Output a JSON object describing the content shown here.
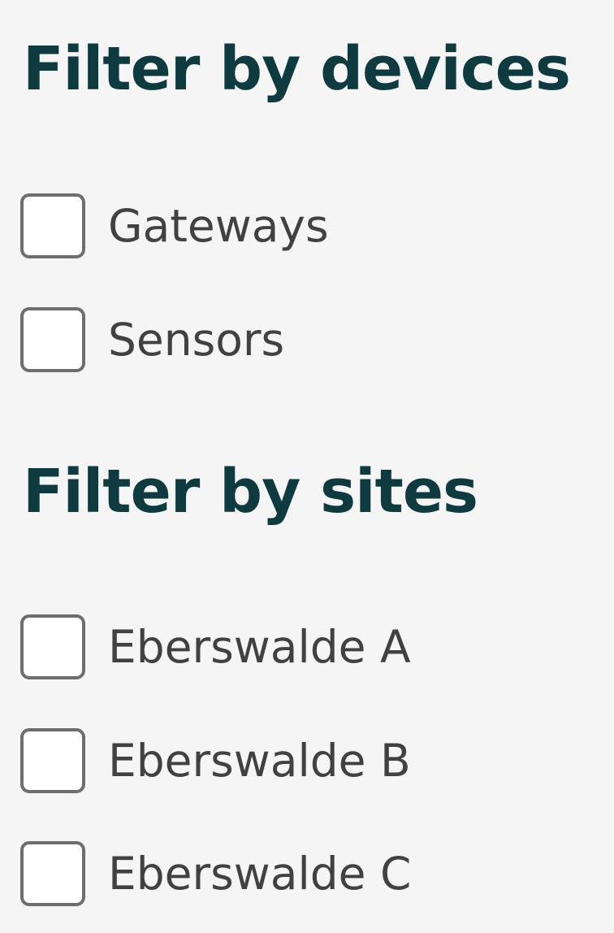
{
  "devices_filter": {
    "title": "Filter by devices",
    "options": [
      {
        "label": "Gateways",
        "checked": false
      },
      {
        "label": "Sensors",
        "checked": false
      }
    ]
  },
  "sites_filter": {
    "title": "Filter by sites",
    "options": [
      {
        "label": "Eberswalde A",
        "checked": false
      },
      {
        "label": "Eberswalde B",
        "checked": false
      },
      {
        "label": "Eberswalde C",
        "checked": false
      }
    ]
  },
  "colors": {
    "heading": "#0f3b40",
    "label": "#414141",
    "checkbox_border": "#6e6e6e",
    "checkbox_fill": "#ffffff",
    "background": "#f5f5f5"
  }
}
